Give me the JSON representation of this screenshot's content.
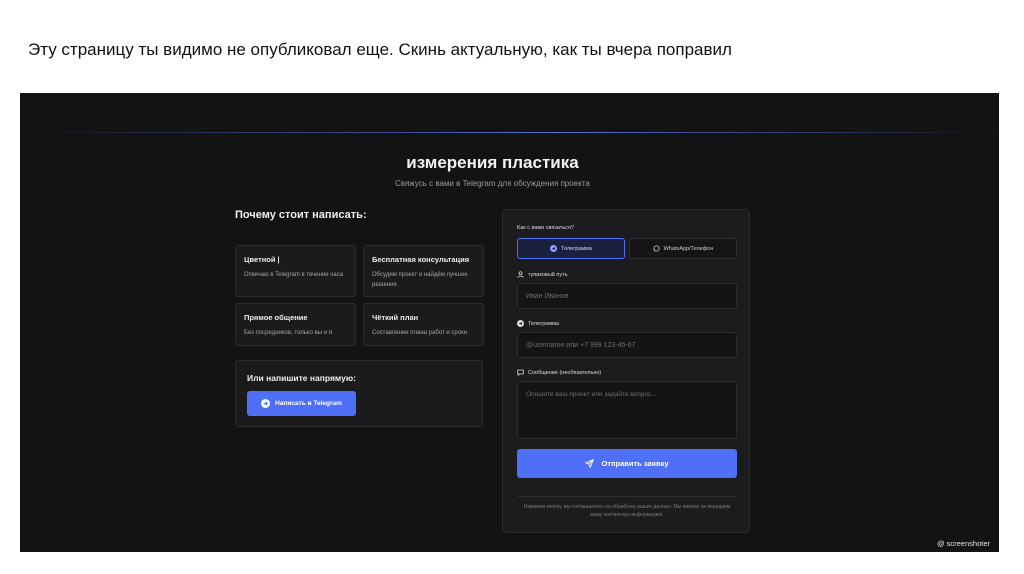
{
  "slide_caption": "Эту страницу ты видимо не опубликовал еще. Скинь актуальную, как ты вчера поправил",
  "page": {
    "title": "измерения пластика",
    "subtitle": "Свяжусь с вами в Telegram для обсуждения проекта"
  },
  "why": {
    "heading": "Почему стоит написать:",
    "cards": [
      {
        "title": "Цветной |",
        "text": "Отвечаю в Telegram в течение часа"
      },
      {
        "title": "Бесплатная консультация",
        "text": "Обсудим проект и найдём лучшее решение"
      },
      {
        "title": "Прямое общение",
        "text": "Без посредников, только вы и я"
      },
      {
        "title": "Чёткий план",
        "text": "Составление плана работ и сроки"
      }
    ]
  },
  "direct": {
    "heading": "Или напишите напрямую:",
    "button_label": "Написать в Telegram"
  },
  "form": {
    "contact_question": "Как с вами связаться?",
    "option_telegram": "Телеграмма",
    "option_whatsapp": "WhatsApp/Телефон",
    "name_label": "тупиковый путь",
    "name_placeholder": "Иван Иванов",
    "telegram_label": "Телеграмма",
    "telegram_placeholder": "@username или +7 999 123-45-67",
    "message_label": "Сообщение (необязательно)",
    "message_placeholder": "Опишите ваш проект или задайте вопрос...",
    "submit_label": "Отправить заявку",
    "consent_note": "Нажимая кнопку, вы соглашаетесь на обработку ваших данных. Мы никому не передаем вашу контактную информацию."
  },
  "watermark": "@ screenshoter",
  "colors": {
    "accent": "#4f6ff6",
    "background": "#131314",
    "card": "#1b1b1d"
  }
}
